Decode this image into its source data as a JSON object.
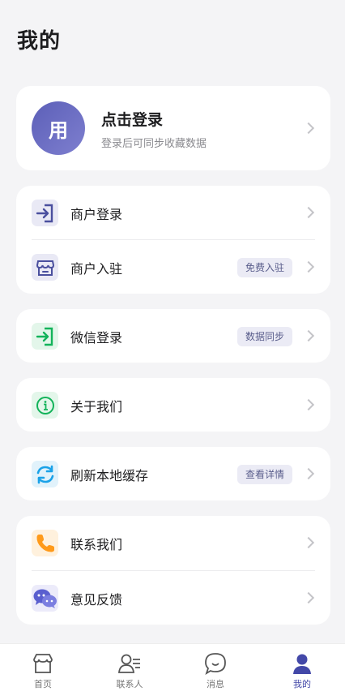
{
  "header": {
    "title": "我的"
  },
  "profile": {
    "avatar_text": "用",
    "title": "点击登录",
    "subtitle": "登录后可同步收藏数据"
  },
  "menu_groups": [
    [
      {
        "label": "商户登录",
        "icon": "login-arrow-icon"
      },
      {
        "label": "商户入驻",
        "icon": "shop-icon",
        "badge": "免费入驻"
      }
    ],
    [
      {
        "label": "微信登录",
        "icon": "wechat-login-icon",
        "badge": "数据同步"
      }
    ],
    [
      {
        "label": "关于我们",
        "icon": "info-icon"
      }
    ],
    [
      {
        "label": "刷新本地缓存",
        "icon": "refresh-icon",
        "badge": "查看详情"
      }
    ],
    [
      {
        "label": "联系我们",
        "icon": "phone-icon"
      },
      {
        "label": "意见反馈",
        "icon": "chat-bubbles-icon"
      }
    ]
  ],
  "tabbar": [
    {
      "label": "首页",
      "icon": "home-icon",
      "active": false
    },
    {
      "label": "联系人",
      "icon": "contacts-icon",
      "active": false
    },
    {
      "label": "消息",
      "icon": "message-icon",
      "active": false
    },
    {
      "label": "我的",
      "icon": "user-icon",
      "active": true
    }
  ],
  "colors": {
    "accent": "#4348a8",
    "avatar": "#6a6cc2",
    "wechat_green": "#13b35a",
    "phone_orange": "#ff9a1a",
    "refresh_blue": "#1aa2e8"
  }
}
